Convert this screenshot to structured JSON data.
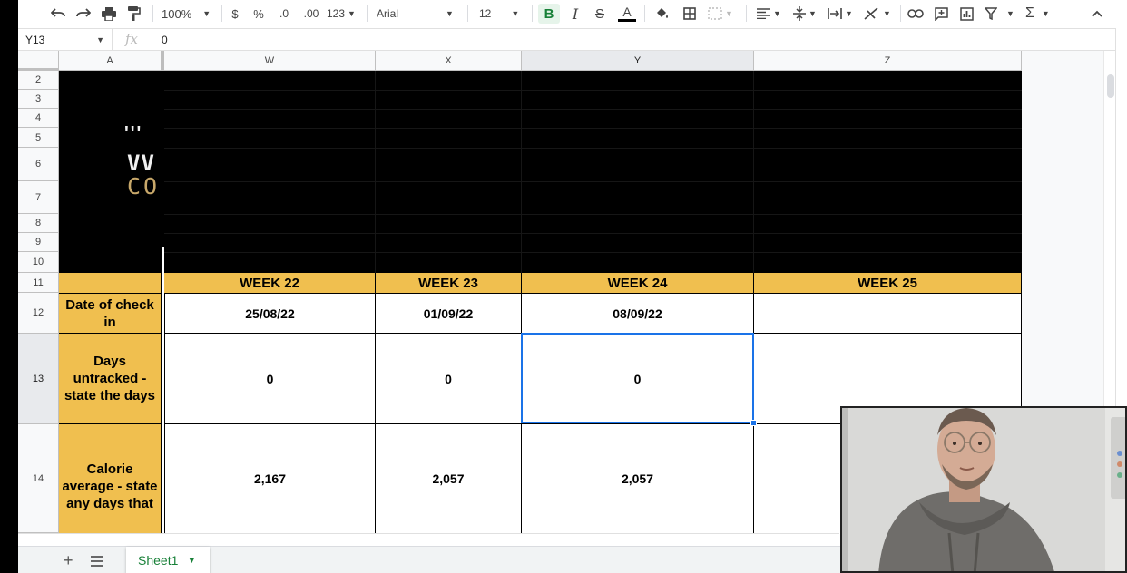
{
  "toolbar": {
    "zoom": "100%",
    "currency": "$",
    "percent": "%",
    "dec_less": ".0",
    "dec_more": ".00",
    "more_formats": "123",
    "font": "Arial",
    "font_size": "12",
    "bold": "B",
    "italic": "I",
    "strike": "S",
    "text_color": "A",
    "sum": "Σ"
  },
  "formula_bar": {
    "name_box": "Y13",
    "fx": "fx",
    "value": "0"
  },
  "columns": [
    "A",
    "W",
    "X",
    "Y",
    "Z"
  ],
  "rows": [
    "2",
    "3",
    "4",
    "5",
    "6",
    "7",
    "8",
    "9",
    "10",
    "11",
    "12",
    "13",
    "14"
  ],
  "banner_logo": {
    "line1": "'''",
    "line2": "VV",
    "line3": "CO"
  },
  "sheet": {
    "weeks": [
      "WEEK 22",
      "WEEK 23",
      "WEEK 24",
      "WEEK 25"
    ],
    "row12_label": "Date of check in",
    "dates": [
      "25/08/22",
      "01/09/22",
      "08/09/22",
      ""
    ],
    "row13_label": "Days untracked - state the days",
    "untracked": [
      "0",
      "0",
      "0",
      ""
    ],
    "row14_label": "Calorie average - state any days that",
    "calories": [
      "2,167",
      "2,057",
      "2,057",
      ""
    ]
  },
  "tabs": {
    "add": "+",
    "sheet_name": "Sheet1"
  },
  "colors": {
    "gold": "#f0bf4f",
    "selection": "#1a73e8",
    "sheet_tab": "#188038"
  }
}
